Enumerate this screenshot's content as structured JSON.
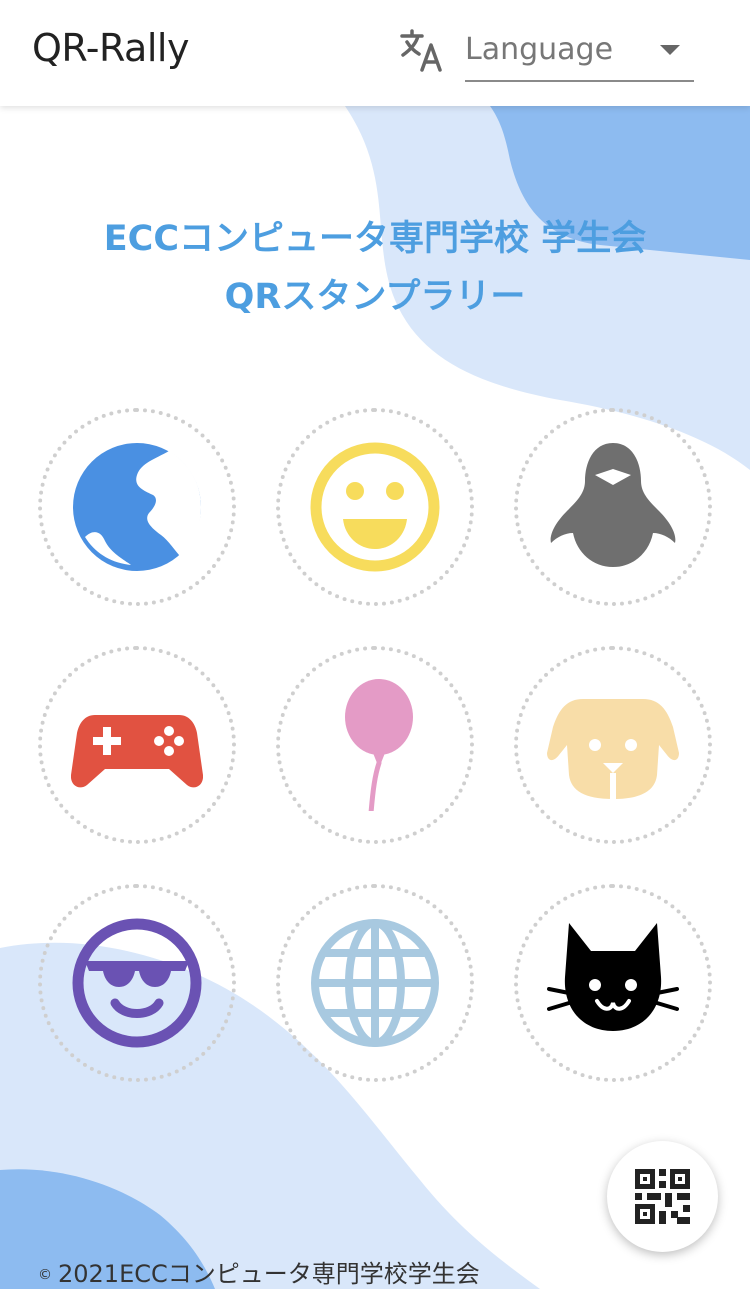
{
  "app": {
    "title": "QR-Rally"
  },
  "language_select": {
    "label": "Language",
    "icon": "translate-icon"
  },
  "heading": {
    "line1": "ECCコンピュータ専門学校 学生会",
    "line2": "QRスタンプラリー"
  },
  "stamps": [
    {
      "icon": "earth-icon",
      "color": "#4a90e2"
    },
    {
      "icon": "smiley-face-icon",
      "color": "#f7dc5c"
    },
    {
      "icon": "penguin-icon",
      "color": "#6f6f6f"
    },
    {
      "icon": "gamepad-icon",
      "color": "#e15241"
    },
    {
      "icon": "balloon-icon",
      "color": "#e49bc6"
    },
    {
      "icon": "dog-icon",
      "color": "#f8dda8"
    },
    {
      "icon": "sunglasses-face-icon",
      "color": "#6a52b3"
    },
    {
      "icon": "globe-icon",
      "color": "#a8c9e0"
    },
    {
      "icon": "cat-icon",
      "color": "#000000"
    }
  ],
  "qr_button": {
    "icon": "qr-code-icon"
  },
  "footer": {
    "symbol": "©",
    "text": "2021ECCコンピュータ専門学校学生会"
  },
  "colors": {
    "heading": "#4d9ee0",
    "wave_light": "#d9e7fa",
    "wave_dark": "#8dbbf0"
  }
}
